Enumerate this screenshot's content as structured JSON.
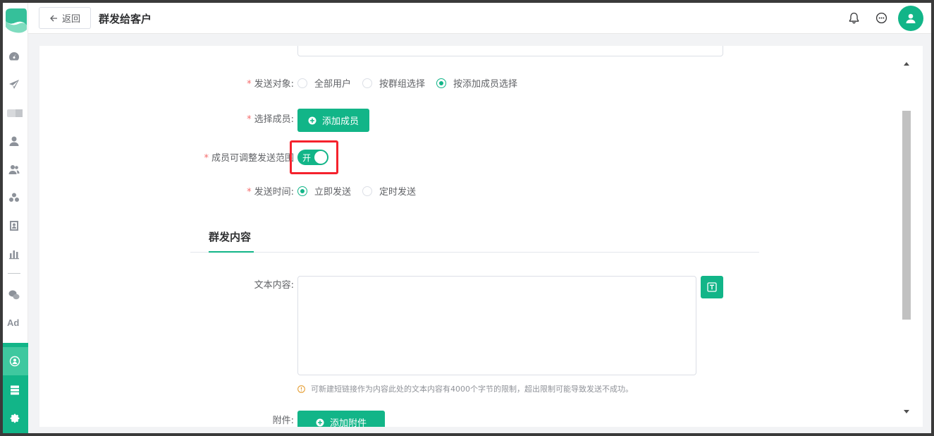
{
  "header": {
    "back_label": "返回",
    "title": "群发给客户",
    "icons": [
      "bell-icon",
      "chat-icon",
      "user-avatar-icon"
    ]
  },
  "form": {
    "send_target": {
      "label": "发送对象:",
      "options": [
        "全部用户",
        "按群组选择",
        "按添加成员选择"
      ],
      "selected": "按添加成员选择"
    },
    "select_member": {
      "label": "选择成员:",
      "button": "添加成员"
    },
    "adjust_scope": {
      "label": "成员可调整发送范围",
      "toggle_text": "开",
      "on": true
    },
    "send_time": {
      "label": "发送时间:",
      "options": [
        "立即发送",
        "定时发送"
      ],
      "selected": "立即发送"
    }
  },
  "content_section": {
    "title": "群发内容",
    "text_label": "文本内容:",
    "text_value": "",
    "tip": "可新建短链接作为内容此处的文本内容有4000个字节的限制，超出限制可能导致发送不成功。",
    "attachment_label": "附件:",
    "attachment_button": "添加附件"
  },
  "colors": {
    "accent": "#12b588",
    "required": "#f56c6c",
    "highlight": "#f5222d"
  }
}
